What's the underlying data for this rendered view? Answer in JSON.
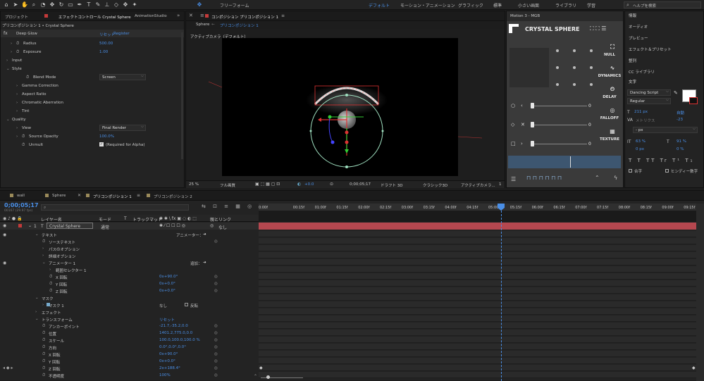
{
  "topbar": {
    "tools": [
      "home-icon",
      "arrow-icon",
      "hand-icon",
      "zoom-icon",
      "orbit-icon",
      "move-icon",
      "rotate-icon",
      "rect-icon",
      "pen-icon",
      "text-icon",
      "brush-icon",
      "stamp-icon",
      "eraser-icon",
      "roto-icon",
      "pin-icon"
    ],
    "snap_label": "フリーフォーム",
    "workspaces": [
      "デフォルト",
      "モーション・アニメーション",
      "グラフィック",
      "標準",
      "小さい画面",
      "ライブラリ",
      "学習"
    ],
    "search_placeholder": "ヘルプを検索"
  },
  "effects_panel": {
    "tabs": [
      "プロジェクト",
      "エフェクトコントロール Crystal Sphere",
      "AnimationStudio"
    ],
    "header": "プリコンポジション 1 • Crystal Sphere",
    "effect_name": "Deep Glow",
    "reset_label": "リセット",
    "register_label": "Register",
    "rows": [
      {
        "label": "Radius",
        "value": "500.00"
      },
      {
        "label": "Exposure",
        "value": "1.00"
      },
      {
        "label": "Input",
        "value": ""
      },
      {
        "label": "Style",
        "value": ""
      },
      {
        "label": "Blend Mode",
        "value": "Screen"
      },
      {
        "label": "Gamma Correction",
        "value": ""
      },
      {
        "label": "Aspect Ratio",
        "value": ""
      },
      {
        "label": "Chromatic Aberration",
        "value": ""
      },
      {
        "label": "Tint",
        "value": ""
      },
      {
        "label": "Quality",
        "value": ""
      },
      {
        "label": "View",
        "value": "Final Render"
      },
      {
        "label": "Source Opacity",
        "value": "100.0%"
      },
      {
        "label": "Unmult",
        "value": "(Required for Alpha)"
      }
    ]
  },
  "comp_panel": {
    "title": "コンポジション プリコンポジション 1",
    "breadcrumb": [
      "Sphere",
      "プリコンポジション 1"
    ],
    "camera_label": "アクティブカメラ（デフォルト）",
    "bottom": {
      "zoom": "25 %",
      "resolution": "フル画質",
      "exposure": "+0.0",
      "timecode": "0;00;05;17",
      "draft": "ドラフト 3D",
      "renderer": "クラシック3D",
      "camera": "アクティブカメラ...",
      "views": "1"
    }
  },
  "motion_panel": {
    "title": "Motion 3 - MGB",
    "brand": "CRYSTAL SPHERE",
    "side_buttons": [
      "NULL",
      "DYNAMICS",
      "DELAY",
      "FALLOFF",
      "TEXTURE"
    ],
    "slider_values": [
      "0",
      "0",
      "0"
    ]
  },
  "right_panel": {
    "items": [
      "情報",
      "オーディオ",
      "プレビュー",
      "エフェクト＆プリセット",
      "整列",
      "CC ライブラリ",
      "文字"
    ],
    "font": "Dancing Script",
    "style": "Regular",
    "size": "211 px",
    "leading": "自動",
    "kerning": "メトリクス",
    "tracking": "-23",
    "stroke_unit": "- px",
    "vscale": "63 %",
    "hscale": "91 %",
    "baseline": "0 px",
    "tsume": "0 %",
    "ligature_label": "合字",
    "hindi_label": "ヒンディー数字"
  },
  "timeline": {
    "tabs": [
      "wall",
      "Sphere",
      "プリコンポジション 1",
      "プリコンポジション 2"
    ],
    "timecode": "0;00;05;17",
    "fps_info": "00167 (29.97 fps)",
    "col_headers": [
      "レイヤー名",
      "モード",
      "T",
      "トラックマット",
      "親とリンク"
    ],
    "ruler_marks": [
      "0:00f",
      "00:15f",
      "01:00f",
      "01:15f",
      "02:00f",
      "02:15f",
      "03:00f",
      "03:15f",
      "04:00f",
      "04:15f",
      "05:00f",
      "05:15f",
      "06:00f",
      "06:15f",
      "07:00f",
      "07:15f",
      "08:00f",
      "08:15f",
      "09:00f",
      "09:15f",
      "10:0"
    ],
    "layer": {
      "num": "1",
      "type": "T",
      "name": "Crystal Sphere",
      "mode": "通常",
      "parent": "なし"
    },
    "rows": [
      {
        "indent": 1,
        "label": "テキスト",
        "value": "アニメーター：",
        "twirl": "open"
      },
      {
        "indent": 2,
        "label": "ソーステキスト",
        "value": "",
        "twirl": "none",
        "stopwatch": true
      },
      {
        "indent": 2,
        "label": "パスのオプション",
        "value": "",
        "twirl": "closed"
      },
      {
        "indent": 2,
        "label": "詳細オプション",
        "value": "",
        "twirl": "closed"
      },
      {
        "indent": 2,
        "label": "アニメーター 1",
        "value": "追加：",
        "twirl": "open"
      },
      {
        "indent": 3,
        "label": "範囲セレクター 1",
        "value": "",
        "twirl": "closed"
      },
      {
        "indent": 3,
        "label": "X 回転",
        "value": "0x+90.0°",
        "twirl": "none",
        "stopwatch": true
      },
      {
        "indent": 3,
        "label": "Y 回転",
        "value": "0x+0.0°",
        "twirl": "none",
        "stopwatch": true
      },
      {
        "indent": 3,
        "label": "Z 回転",
        "value": "0x+0.0°",
        "twirl": "none",
        "stopwatch": true
      },
      {
        "indent": 1,
        "label": "マスク",
        "value": "",
        "twirl": "open"
      },
      {
        "indent": 2,
        "label": "マスク 1",
        "value": "なし",
        "extra": "反転",
        "twirl": "closed"
      },
      {
        "indent": 1,
        "label": "エフェクト",
        "value": "",
        "twirl": "closed"
      },
      {
        "indent": 1,
        "label": "トランスフォーム",
        "value": "リセット",
        "twirl": "open"
      },
      {
        "indent": 2,
        "label": "アンカーポイント",
        "value": "-21.7,-35.2,0.0",
        "twirl": "none",
        "stopwatch": true
      },
      {
        "indent": 2,
        "label": "位置",
        "value": "1401.2,775.0,0.0",
        "twirl": "none",
        "stopwatch": true
      },
      {
        "indent": 2,
        "label": "スケール",
        "value": "100.0,100.0,100.0 %",
        "twirl": "none",
        "stopwatch": true
      },
      {
        "indent": 2,
        "label": "方向",
        "value": "0.0°,0.0°,0.0°",
        "twirl": "none",
        "stopwatch": true
      },
      {
        "indent": 2,
        "label": "X 回転",
        "value": "0x+90.0°",
        "twirl": "none",
        "stopwatch": true
      },
      {
        "indent": 2,
        "label": "Y 回転",
        "value": "0x+0.0°",
        "twirl": "none",
        "stopwatch": true
      },
      {
        "indent": 2,
        "label": "Z 回転",
        "value": "2x+188.4°",
        "twirl": "none",
        "stopwatch": true
      },
      {
        "indent": 2,
        "label": "不透明度",
        "value": "100%",
        "twirl": "none",
        "stopwatch": true
      }
    ]
  },
  "colors": {
    "accent": "#4a8fe7",
    "layer_bar": "#b5474f",
    "bg": "#1d1d1d"
  }
}
